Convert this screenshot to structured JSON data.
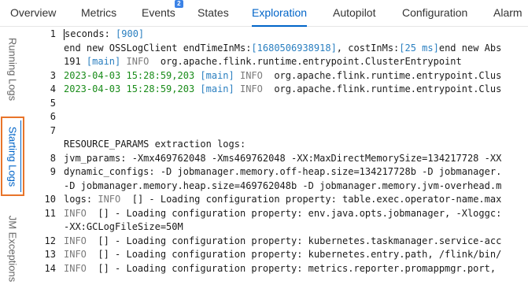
{
  "tabs": [
    {
      "label": "Overview"
    },
    {
      "label": "Metrics"
    },
    {
      "label": "Events",
      "badge": "2"
    },
    {
      "label": "States"
    },
    {
      "label": "Exploration",
      "active": true
    },
    {
      "label": "Autopilot"
    },
    {
      "label": "Configuration"
    },
    {
      "label": "Alarm"
    }
  ],
  "side_tabs": [
    {
      "label": "Running Logs"
    },
    {
      "label": "Starting Logs",
      "active": true
    },
    {
      "label": "JM Exceptions"
    }
  ],
  "colors": {
    "accent": "#0064c8",
    "highlight_border": "#e8742a",
    "timestamp": "#1a8c1a",
    "bracket_value": "#2a7fc0",
    "level": "#7a7a7a"
  },
  "log_lines": [
    {
      "num": "1",
      "segments": [
        {
          "t": "seconds: ",
          "c": "b"
        },
        {
          "t": "[900]",
          "c": "c"
        }
      ]
    },
    {
      "num": "",
      "segments": [
        {
          "t": "end new OSSLogClient endTimeInMs:",
          "c": "b"
        },
        {
          "t": "[1680506938918]",
          "c": "c"
        },
        {
          "t": ", costInMs:",
          "c": "b"
        },
        {
          "t": "[25 ms]",
          "c": "c"
        },
        {
          "t": "end new Abs",
          "c": "b"
        }
      ]
    },
    {
      "num": "",
      "segments": [
        {
          "t": "191 ",
          "c": "b"
        },
        {
          "t": "[main]",
          "c": "c"
        },
        {
          "t": " INFO  ",
          "c": "g"
        },
        {
          "t": "org.apache.flink.runtime.entrypoint.ClusterEntrypoint",
          "c": "b"
        }
      ]
    },
    {
      "num": "3",
      "segments": [
        {
          "t": "2023-04-03 15:28:59,203",
          "c": "d"
        },
        {
          "t": " [main]",
          "c": "c"
        },
        {
          "t": " INFO  ",
          "c": "g"
        },
        {
          "t": "org.apache.flink.runtime.entrypoint.Clus",
          "c": "b"
        }
      ]
    },
    {
      "num": "4",
      "segments": [
        {
          "t": "2023-04-03 15:28:59,203",
          "c": "d"
        },
        {
          "t": " [main]",
          "c": "c"
        },
        {
          "t": " INFO  ",
          "c": "g"
        },
        {
          "t": "org.apache.flink.runtime.entrypoint.Clus",
          "c": "b"
        }
      ]
    },
    {
      "num": "5",
      "segments": []
    },
    {
      "num": "6",
      "segments": []
    },
    {
      "num": "7",
      "segments": []
    },
    {
      "num": "",
      "segments": [
        {
          "t": "RESOURCE_PARAMS extraction logs:",
          "c": "b"
        }
      ]
    },
    {
      "num": "8",
      "segments": [
        {
          "t": "jvm_params: -Xmx469762048 -Xms469762048 -XX:MaxDirectMemorySize=134217728 -XX",
          "c": "b"
        }
      ]
    },
    {
      "num": "9",
      "segments": [
        {
          "t": "dynamic_configs: -D jobmanager.memory.off-heap.size=134217728b -D jobmanager.",
          "c": "b"
        }
      ]
    },
    {
      "num": "",
      "segments": [
        {
          "t": "-D jobmanager.memory.heap.size=469762048b -D jobmanager.memory.jvm-overhead.m",
          "c": "b"
        }
      ]
    },
    {
      "num": "10",
      "segments": [
        {
          "t": "logs: ",
          "c": "b"
        },
        {
          "t": "INFO",
          "c": "g"
        },
        {
          "t": "  [] - Loading configuration property: table.exec.operator-name.max",
          "c": "b"
        }
      ]
    },
    {
      "num": "11",
      "segments": [
        {
          "t": "INFO",
          "c": "g"
        },
        {
          "t": "  [] - Loading configuration property: env.java.opts.jobmanager, -Xloggc:",
          "c": "b"
        }
      ]
    },
    {
      "num": "",
      "segments": [
        {
          "t": "-XX:GCLogFileSize=50M",
          "c": "b"
        }
      ]
    },
    {
      "num": "12",
      "segments": [
        {
          "t": "INFO",
          "c": "g"
        },
        {
          "t": "  [] - Loading configuration property: kubernetes.taskmanager.service-acc",
          "c": "b"
        }
      ]
    },
    {
      "num": "13",
      "segments": [
        {
          "t": "INFO",
          "c": "g"
        },
        {
          "t": "  [] - Loading configuration property: kubernetes.entry.path, /flink/bin/",
          "c": "b"
        }
      ]
    },
    {
      "num": "14",
      "segments": [
        {
          "t": "INFO",
          "c": "g"
        },
        {
          "t": "  [] - Loading configuration property: metrics.reporter.promappmgr.port,",
          "c": "b"
        }
      ]
    }
  ]
}
